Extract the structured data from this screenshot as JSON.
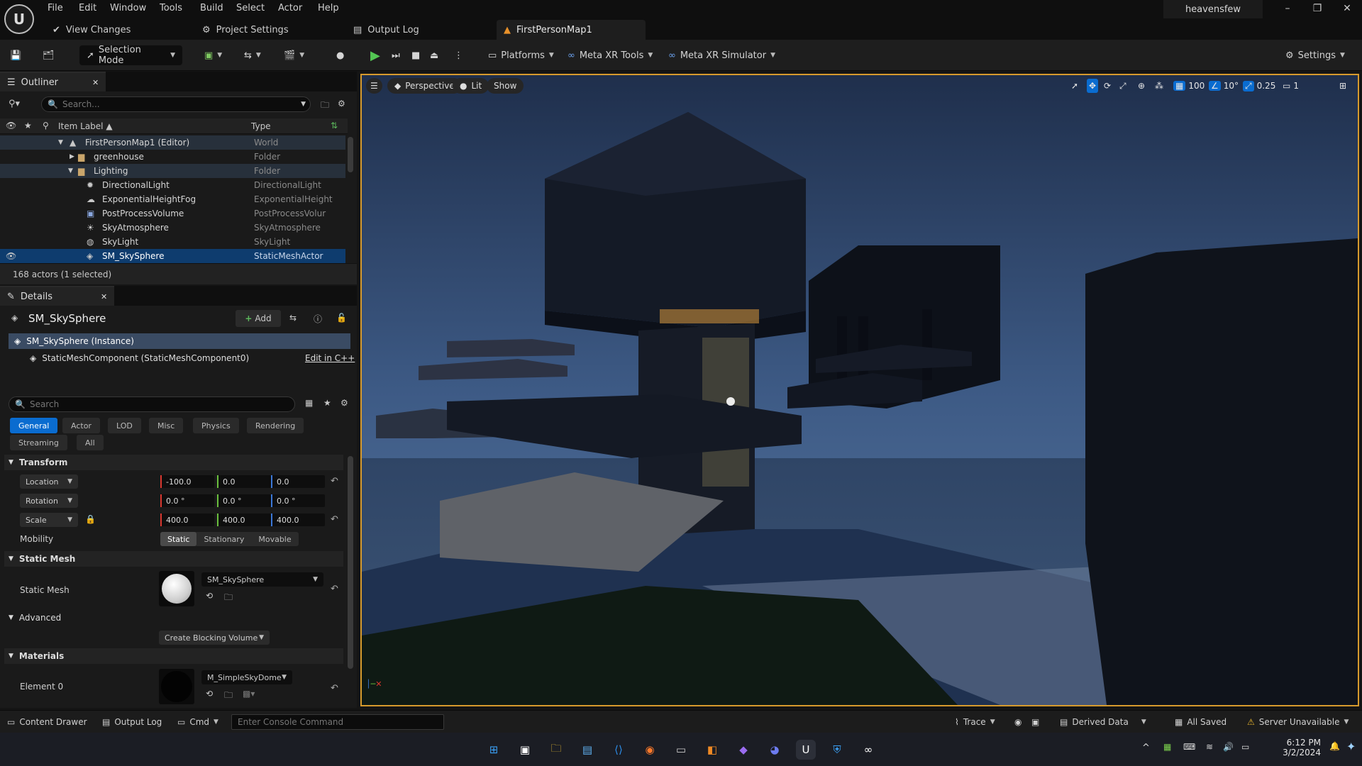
{
  "menubar": {
    "items": [
      "File",
      "Edit",
      "Window",
      "Tools",
      "Build",
      "Select",
      "Actor",
      "Help"
    ],
    "tabs": [
      {
        "icon": "check-circle-icon",
        "label": "View Changes"
      },
      {
        "icon": "gear-icon",
        "label": "Project Settings"
      },
      {
        "icon": "log-icon",
        "label": "Output Log"
      },
      {
        "icon": "level-icon",
        "label": "FirstPersonMap1"
      }
    ],
    "user": "heavensfew"
  },
  "toolbar": {
    "selection_mode": "Selection Mode",
    "platforms": "Platforms",
    "meta_xr_tools": "Meta XR Tools",
    "meta_xr_simulator": "Meta XR Simulator",
    "settings": "Settings"
  },
  "outliner": {
    "tab": "Outliner",
    "search_placeholder": "Search...",
    "col_label": "Item Label ▲",
    "col_type": "Type",
    "rows": [
      {
        "label": "FirstPersonMap1 (Editor)",
        "type": "World"
      },
      {
        "label": "greenhouse",
        "type": "Folder"
      },
      {
        "label": "Lighting",
        "type": "Folder"
      },
      {
        "label": "DirectionalLight",
        "type": "DirectionalLight"
      },
      {
        "label": "ExponentialHeightFog",
        "type": "ExponentialHeight"
      },
      {
        "label": "PostProcessVolume",
        "type": "PostProcessVolur"
      },
      {
        "label": "SkyAtmosphere",
        "type": "SkyAtmosphere"
      },
      {
        "label": "SkyLight",
        "type": "SkyLight"
      },
      {
        "label": "SM_SkySphere",
        "type": "StaticMeshActor"
      }
    ],
    "status": "168 actors (1 selected)"
  },
  "details": {
    "tab": "Details",
    "actor_name": "SM_SkySphere",
    "add_label": "Add",
    "instance": "SM_SkySphere (Instance)",
    "component": "StaticMeshComponent (StaticMeshComponent0)",
    "edit_cpp": "Edit in C++",
    "search_placeholder": "Search",
    "categories": [
      "General",
      "Actor",
      "LOD",
      "Misc",
      "Physics",
      "Rendering",
      "Streaming",
      "All"
    ],
    "transform": {
      "title": "Transform",
      "location_label": "Location",
      "rotation_label": "Rotation",
      "scale_label": "Scale",
      "location": [
        "-100.0",
        "0.0",
        "0.0"
      ],
      "rotation": [
        "0.0 °",
        "0.0 °",
        "0.0 °"
      ],
      "scale": [
        "400.0",
        "400.0",
        "400.0"
      ],
      "mobility_label": "Mobility",
      "mobility": [
        "Static",
        "Stationary",
        "Movable"
      ]
    },
    "static_mesh": {
      "title": "Static Mesh",
      "label": "Static Mesh",
      "value": "SM_SkySphere"
    },
    "advanced": {
      "title": "Advanced",
      "button": "Create Blocking Volume"
    },
    "materials": {
      "title": "Materials",
      "element_label": "Element 0",
      "value": "M_SimpleSkyDome"
    }
  },
  "viewport": {
    "perspective": "Perspective",
    "lit": "Lit",
    "show": "Show",
    "grid_snap": "100",
    "rot_snap": "10°",
    "scale_snap": "0.25",
    "cam_speed": "1"
  },
  "statusbar": {
    "content_drawer": "Content Drawer",
    "output_log": "Output Log",
    "cmd": "Cmd",
    "console_placeholder": "Enter Console Command",
    "trace": "Trace",
    "derived_data": "Derived Data",
    "all_saved": "All Saved",
    "server": "Server Unavailable"
  },
  "taskbar": {
    "time": "6:12 PM",
    "date": "3/2/2024"
  }
}
